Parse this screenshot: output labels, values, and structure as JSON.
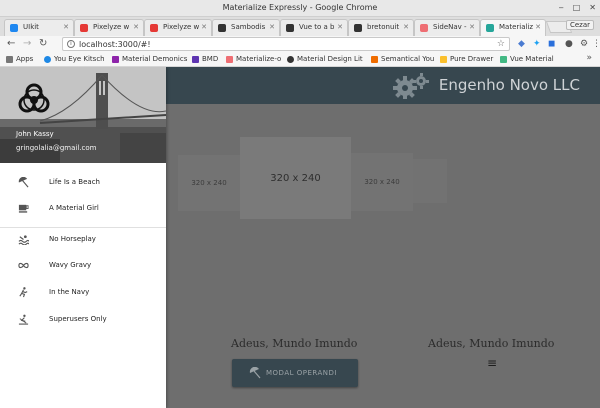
{
  "window": {
    "title": "Materialize Expressly - Google Chrome",
    "controls": [
      "‒",
      "□",
      "✕"
    ]
  },
  "tabs": [
    {
      "label": "UIkit",
      "color": "#1e87f0",
      "active": false
    },
    {
      "label": "Pixelyze w",
      "color": "#e53935",
      "active": false
    },
    {
      "label": "Pixelyze w",
      "color": "#e53935",
      "active": false
    },
    {
      "label": "Sambodis",
      "color": "#333333",
      "active": false
    },
    {
      "label": "Vue to a b",
      "color": "#333333",
      "active": false
    },
    {
      "label": "bretonuit",
      "color": "#333333",
      "active": false
    },
    {
      "label": "SideNav -",
      "color": "#ee6e73",
      "active": false
    },
    {
      "label": "Materializ",
      "color": "#26a69a",
      "active": true
    }
  ],
  "profile": "Cezar",
  "address": {
    "url": "localhost:3000/#!"
  },
  "bookmarks": [
    {
      "label": "Apps",
      "color": "#555555"
    },
    {
      "label": "You Eye Kitsch",
      "color": "#1e88e5"
    },
    {
      "label": "Material Demonics",
      "color": "#8e24aa"
    },
    {
      "label": "BMD",
      "color": "#5e35b1"
    },
    {
      "label": "Materialize-o",
      "color": "#ee6e73"
    },
    {
      "label": "Material Design Lit",
      "color": "#333333"
    },
    {
      "label": "Semantical You",
      "color": "#ef6c00"
    },
    {
      "label": "Pure Drawer",
      "color": "#fbc02d"
    },
    {
      "label": "Vue Material",
      "color": "#42b883"
    }
  ],
  "bookmarks_more": "»",
  "brand": "Engenho Novo LLC",
  "user": {
    "name": "John Kassy",
    "email": "gringolalia@gmail.com"
  },
  "nav": [
    {
      "label": "Life Is a Beach",
      "icon": "beach-umbrella-icon"
    },
    {
      "label": "A Material Girl",
      "icon": "coffee-cup-icon"
    },
    {
      "label": "No Horseplay",
      "icon": "pool-icon"
    },
    {
      "label": "Wavy Gravy",
      "icon": "infinity-icon"
    },
    {
      "label": "In the Navy",
      "icon": "running-figure-icon"
    },
    {
      "label": "Superusers Only",
      "icon": "rowing-icon"
    }
  ],
  "carousel": [
    {
      "label": "320 x 240"
    },
    {
      "label": "320 x 240"
    },
    {
      "label": "320 x 240"
    },
    {
      "label": ""
    }
  ],
  "content": {
    "heading_left": "Adeus, Mundo Imundo",
    "heading_right": "Adeus, Mundo Imundo",
    "modal_button": "MODAL OPERANDI"
  }
}
